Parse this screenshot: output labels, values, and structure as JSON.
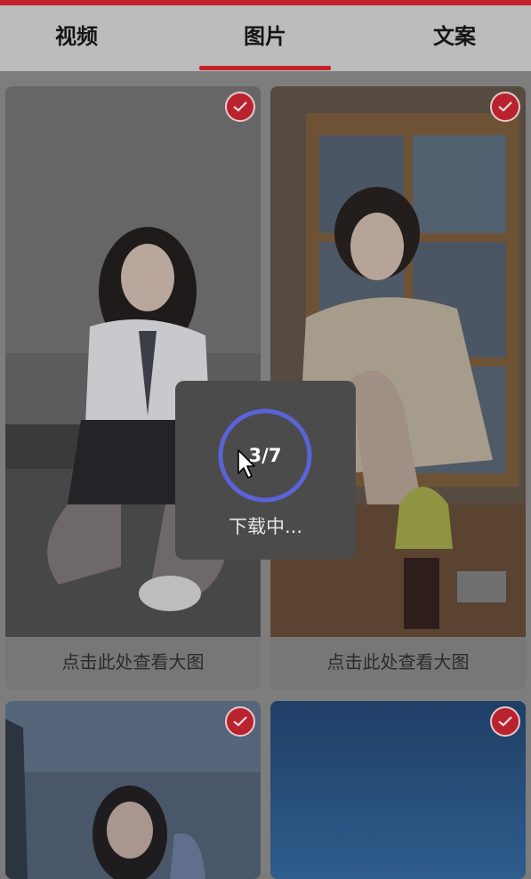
{
  "tabs": [
    {
      "label": "视频"
    },
    {
      "label": "图片"
    },
    {
      "label": "文案"
    }
  ],
  "active_tab": "图片",
  "cards": [
    {
      "caption": "点击此处查看大图",
      "selected": true
    },
    {
      "caption": "点击此处查看大图",
      "selected": true
    },
    {
      "caption": "",
      "selected": true
    },
    {
      "caption": "",
      "selected": true
    }
  ],
  "download": {
    "progress_text": "3/7",
    "status_text": "下载中...",
    "progress_fraction": 0.4286
  },
  "colors": {
    "accent": "#c4212b",
    "ring": "#5b63d8"
  }
}
